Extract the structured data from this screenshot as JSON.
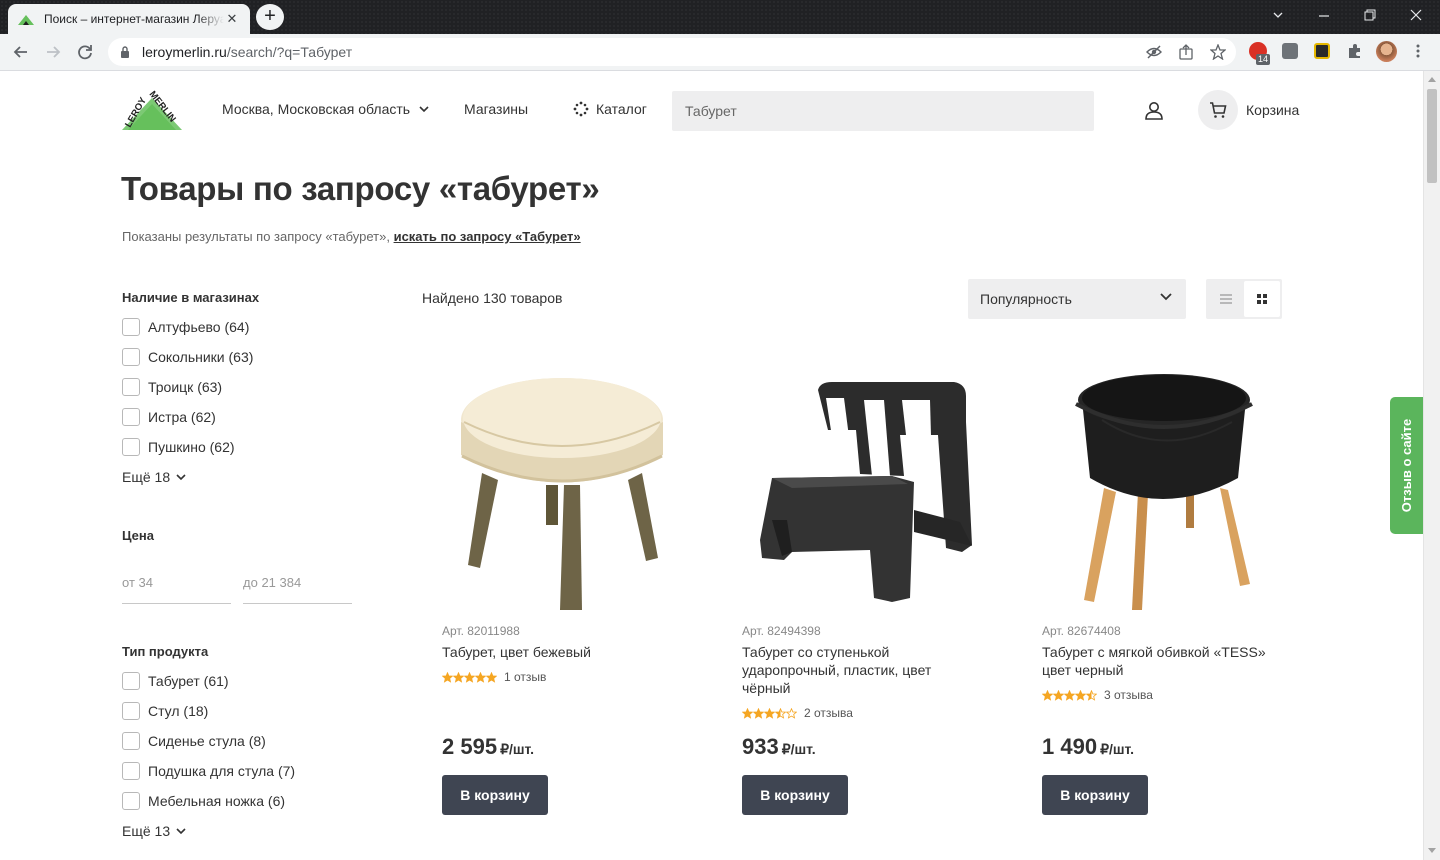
{
  "browser": {
    "tab_title": "Поиск – интернет-магазин Леруа Мерлен",
    "tab_close": "✕",
    "new_tab": "+",
    "url_host": "leroymerlin.ru",
    "url_path": "/search/?q=Табурет",
    "ext_badge": "14"
  },
  "header": {
    "region": "Москва, Московская область",
    "stores": "Магазины",
    "catalog": "Каталог",
    "search_value": "Табурет",
    "cart": "Корзина"
  },
  "page": {
    "title": "Товары по запросу «табурет»",
    "subtitle_prefix": "Показаны результаты по запросу «табурет», ",
    "subtitle_link": "искать по запросу «Табурет»"
  },
  "filters": {
    "stores_title": "Наличие в магазинах",
    "stores": [
      "Алтуфьево (64)",
      "Сокольники (63)",
      "Троицк (63)",
      "Истра (62)",
      "Пушкино (62)"
    ],
    "stores_more": "Ещё 18",
    "price_title": "Цена",
    "price_from_label": "от",
    "price_from": "34",
    "price_to_label": "до",
    "price_to": "21 384",
    "type_title": "Тип продукта",
    "types": [
      "Табурет (61)",
      "Стул (18)",
      "Сиденье стула (8)",
      "Подушка для стула (7)",
      "Мебельная ножка (6)"
    ],
    "types_more": "Ещё 13"
  },
  "results": {
    "found": "Найдено 130 товаров",
    "sort": "Популярность"
  },
  "products": [
    {
      "art": "Арт. 82011988",
      "name": "Табурет, цвет бежевый",
      "rating": 5,
      "reviews": "1 отзыв",
      "price": "2 595",
      "unit": "₽/шт.",
      "buy": "В корзину"
    },
    {
      "art": "Арт. 82494398",
      "name": "Табурет со ступенькой ударопрочный, пластик, цвет чёрный",
      "rating": 3.5,
      "reviews": "2 отзыва",
      "price": "933",
      "unit": "₽/шт.",
      "buy": "В корзину"
    },
    {
      "art": "Арт. 82674408",
      "name": "Табурет с мягкой обивкой «TESS» цвет черный",
      "rating": 4.5,
      "reviews": "3 отзыва",
      "price": "1 490",
      "unit": "₽/шт.",
      "buy": "В корзину"
    }
  ],
  "feedback": "Отзыв о сайте",
  "colors": {
    "brand_green": "#66c05c",
    "button_dark": "#3f4552",
    "star": "#f5a623",
    "feedback_green": "#5bb55c"
  }
}
